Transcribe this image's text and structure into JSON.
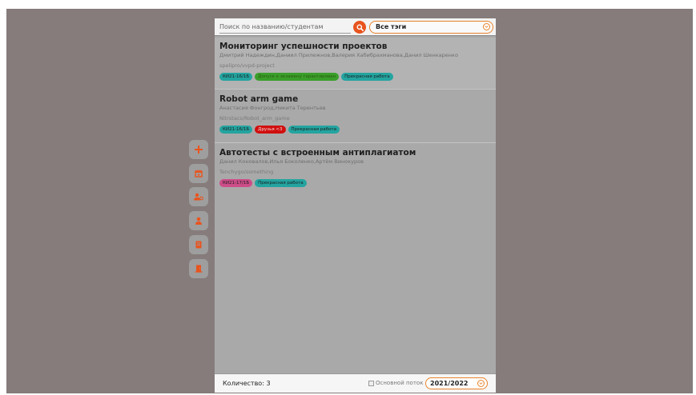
{
  "search": {
    "placeholder": "Поиск по названию/студентам",
    "tag_filter": "Все тэги"
  },
  "projects": [
    {
      "title": "Мониторинг успешности проектов",
      "authors": "Дмитрий Надеждин,Даниил Прилежнов,Валерия Хабибрахманова,Данил Шенкаренко",
      "repo": "spelipro/vvpd-project",
      "tags": [
        "КИ21-16/1Б",
        "Допуск к экзамену гарантирован",
        "Прекрасная работа"
      ]
    },
    {
      "title": "Robot arm game",
      "authors": "Анастасия Фонгрод,Никита Терентьев",
      "repo": "Nitrstacs/Robot_arm_game",
      "tags": [
        "КИ21-16/1Б",
        "Друзья <3",
        "Прекрасная работа"
      ]
    },
    {
      "title": "Автотесты с встроенным антиплагиатом",
      "authors": "Данил Коновалов,Илья Боколенко,Артём Винокуров",
      "repo": "Tenchygo/something",
      "tags": [
        "КИ21-17/1Б",
        "Прекрасная работа"
      ]
    }
  ],
  "footer": {
    "count_label": "Количество: 3",
    "main_stream_label": "Основной поток",
    "year": "2021/2022"
  },
  "colors": {
    "accent": "#e8541e",
    "backdrop": "#857c7b"
  },
  "sidebar_icons": [
    "plus-icon",
    "calendar-icon",
    "user-settings-icon",
    "user-icon",
    "book-icon",
    "door-exit-icon"
  ]
}
